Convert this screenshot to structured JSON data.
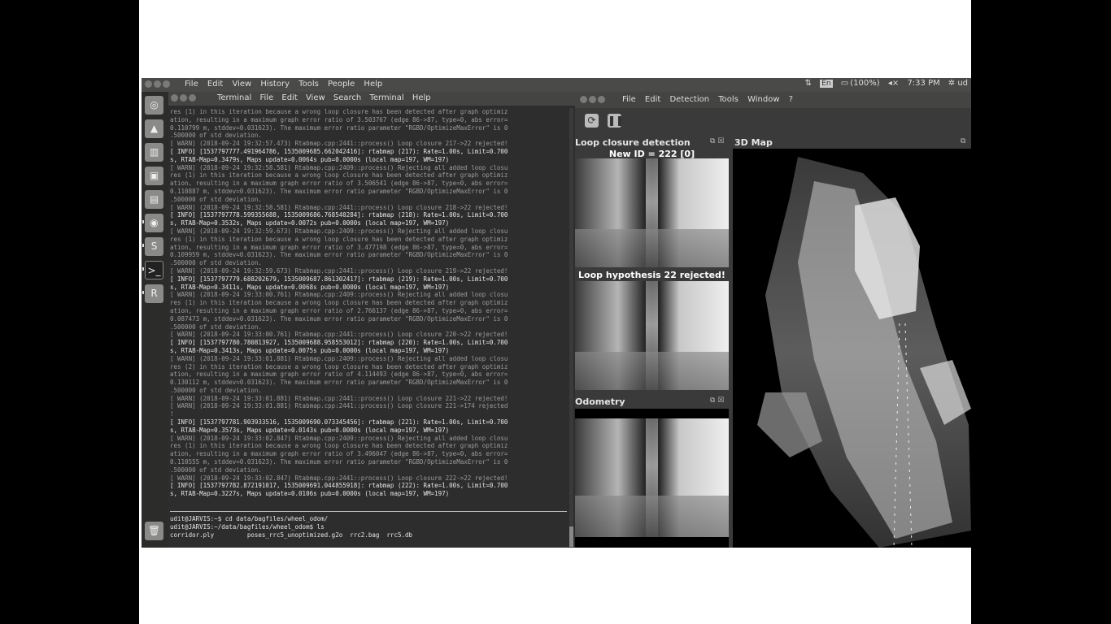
{
  "top_panel": {
    "menu": [
      "File",
      "Edit",
      "View",
      "History",
      "Tools",
      "People",
      "Help"
    ],
    "language": "En",
    "battery": "(100%)",
    "time": "7:33 PM",
    "user": "ud"
  },
  "launcher": {
    "icons": [
      "ubuntu-dash",
      "files",
      "system-settings",
      "software-center",
      "file-manager",
      "chrome",
      "sublime",
      "terminal",
      "rtabmap",
      "trash"
    ]
  },
  "terminal": {
    "title": "Terminal",
    "menu": [
      "File",
      "Edit",
      "View",
      "Search",
      "Terminal",
      "Help"
    ],
    "log": [
      [
        "w",
        "res (1) in this iteration because a wrong loop closure has been detected after graph optimiz"
      ],
      [
        "w",
        "ation, resulting in a maximum graph error ratio of 3.503767 (edge 86->87, type=0, abs error="
      ],
      [
        "w",
        "0.110799 m, stddev=0.031623). The maximum error ratio parameter \"RGBD/OptimizeMaxError\" is 0"
      ],
      [
        "w",
        ".500000 of std deviation."
      ],
      [
        "w",
        "[ WARN] (2018-09-24 19:32:57.473) Rtabmap.cpp:2441::process() Loop closure 217->22 rejected!"
      ],
      [
        "i",
        "[ INFO] [1537797777.491964786, 1535009685.662042416]: rtabmap (217): Rate=1.00s, Limit=0.700"
      ],
      [
        "i",
        "s, RTAB-Map=0.3479s, Maps update=0.0064s pub=0.0000s (local map=197, WM=197)"
      ],
      [
        "w",
        "[ WARN] (2018-09-24 19:32:58.581) Rtabmap.cpp:2409::process() Rejecting all added loop closu"
      ],
      [
        "w",
        "res (1) in this iteration because a wrong loop closure has been detected after graph optimiz"
      ],
      [
        "w",
        "ation, resulting in a maximum graph error ratio of 3.506541 (edge 86->87, type=0, abs error="
      ],
      [
        "w",
        "0.110887 m, stddev=0.031623). The maximum error ratio parameter \"RGBD/OptimizeMaxError\" is 0"
      ],
      [
        "w",
        ".500000 of std deviation."
      ],
      [
        "w",
        "[ WARN] (2018-09-24 19:32:58.581) Rtabmap.cpp:2441::process() Loop closure 218->22 rejected!"
      ],
      [
        "i",
        "[ INFO] [1537797778.599355688, 1535009686.768540284]: rtabmap (218): Rate=1.00s, Limit=0.700"
      ],
      [
        "i",
        "s, RTAB-Map=0.3532s, Maps update=0.0072s pub=0.0000s (local map=197, WM=197)"
      ],
      [
        "w",
        "[ WARN] (2018-09-24 19:32:59.673) Rtabmap.cpp:2409::process() Rejecting all added loop closu"
      ],
      [
        "w",
        "res (1) in this iteration because a wrong loop closure has been detected after graph optimiz"
      ],
      [
        "w",
        "ation, resulting in a maximum graph error ratio of 3.477198 (edge 86->87, type=0, abs error="
      ],
      [
        "w",
        "0.109959 m, stddev=0.031623). The maximum error ratio parameter \"RGBD/OptimizeMaxError\" is 0"
      ],
      [
        "w",
        ".500000 of std deviation."
      ],
      [
        "w",
        "[ WARN] (2018-09-24 19:32:59.673) Rtabmap.cpp:2441::process() Loop closure 219->22 rejected!"
      ],
      [
        "i",
        "[ INFO] [1537797779.688202679, 1535009687.861302417]: rtabmap (219): Rate=1.00s, Limit=0.700"
      ],
      [
        "i",
        "s, RTAB-Map=0.3411s, Maps update=0.0068s pub=0.0000s (local map=197, WM=197)"
      ],
      [
        "w",
        "[ WARN] (2018-09-24 19:33:00.761) Rtabmap.cpp:2409::process() Rejecting all added loop closu"
      ],
      [
        "w",
        "res (1) in this iteration because a wrong loop closure has been detected after graph optimiz"
      ],
      [
        "w",
        "ation, resulting in a maximum graph error ratio of 2.766137 (edge 86->87, type=0, abs error="
      ],
      [
        "w",
        "0.087473 m, stddev=0.031623). The maximum error ratio parameter \"RGBD/OptimizeMaxError\" is 0"
      ],
      [
        "w",
        ".500000 of std deviation."
      ],
      [
        "w",
        "[ WARN] (2018-09-24 19:33:00.761) Rtabmap.cpp:2441::process() Loop closure 220->22 rejected!"
      ],
      [
        "i",
        "[ INFO] [1537797780.780813927, 1535009688.958553012]: rtabmap (220): Rate=1.00s, Limit=0.700"
      ],
      [
        "i",
        "s, RTAB-Map=0.3413s, Maps update=0.0075s pub=0.0000s (local map=197, WM=197)"
      ],
      [
        "w",
        "[ WARN] (2018-09-24 19:33:01.881) Rtabmap.cpp:2409::process() Rejecting all added loop closu"
      ],
      [
        "w",
        "res (2) in this iteration because a wrong loop closure has been detected after graph optimiz"
      ],
      [
        "w",
        "ation, resulting in a maximum graph error ratio of 4.114493 (edge 86->87, type=0, abs error="
      ],
      [
        "w",
        "0.130112 m, stddev=0.031623). The maximum error ratio parameter \"RGBD/OptimizeMaxError\" is 0"
      ],
      [
        "w",
        ".500000 of std deviation."
      ],
      [
        "w",
        "[ WARN] (2018-09-24 19:33:01.881) Rtabmap.cpp:2441::process() Loop closure 221->22 rejected!"
      ],
      [
        "w",
        "[ WARN] (2018-09-24 19:33:01.881) Rtabmap.cpp:2441::process() Loop closure 221->174 rejected"
      ],
      [
        "w",
        "!"
      ],
      [
        "i",
        "[ INFO] [1537797781.903933516, 1535009690.073345456]: rtabmap (221): Rate=1.00s, Limit=0.700"
      ],
      [
        "i",
        "s, RTAB-Map=0.3573s, Maps update=0.0143s pub=0.0000s (local map=197, WM=197)"
      ],
      [
        "w",
        "[ WARN] (2018-09-24 19:33:02.847) Rtabmap.cpp:2409::process() Rejecting all added loop closu"
      ],
      [
        "w",
        "res (1) in this iteration because a wrong loop closure has been detected after graph optimiz"
      ],
      [
        "w",
        "ation, resulting in a maximum graph error ratio of 3.496047 (edge 86->87, type=0, abs error="
      ],
      [
        "w",
        "0.110555 m, stddev=0.031623). The maximum error ratio parameter \"RGBD/OptimizeMaxError\" is 0"
      ],
      [
        "w",
        ".500000 of std deviation."
      ],
      [
        "w",
        "[ WARN] (2018-09-24 19:33:02.847) Rtabmap.cpp:2441::process() Loop closure 222->22 rejected!"
      ],
      [
        "i",
        "[ INFO] [1537797782.872191017, 1535009691.044855918]: rtabmap (222): Rate=1.00s, Limit=0.700"
      ],
      [
        "i",
        "s, RTAB-Map=0.3227s, Maps update=0.0106s pub=0.0000s (local map=197, WM=197)"
      ]
    ],
    "prompt": [
      "udit@JARVIS:~$ cd data/bagfiles/wheel_odom/",
      "udit@JARVIS:~/data/bagfiles/wheel_odom$ ls",
      "corridor.ply         poses_rrc5_unoptimized.g2o  rrc2.bag  rrc5.db"
    ]
  },
  "rtabmap": {
    "menu": [
      "File",
      "Edit",
      "Detection",
      "Tools",
      "Window",
      "?"
    ],
    "loop_closure": {
      "title": "Loop closure detection",
      "new_id": "New ID = 222 [0]",
      "hypothesis": "Loop hypothesis 22 rejected!"
    },
    "odometry": {
      "title": "Odometry"
    },
    "map3d": {
      "title": "3D Map"
    }
  }
}
